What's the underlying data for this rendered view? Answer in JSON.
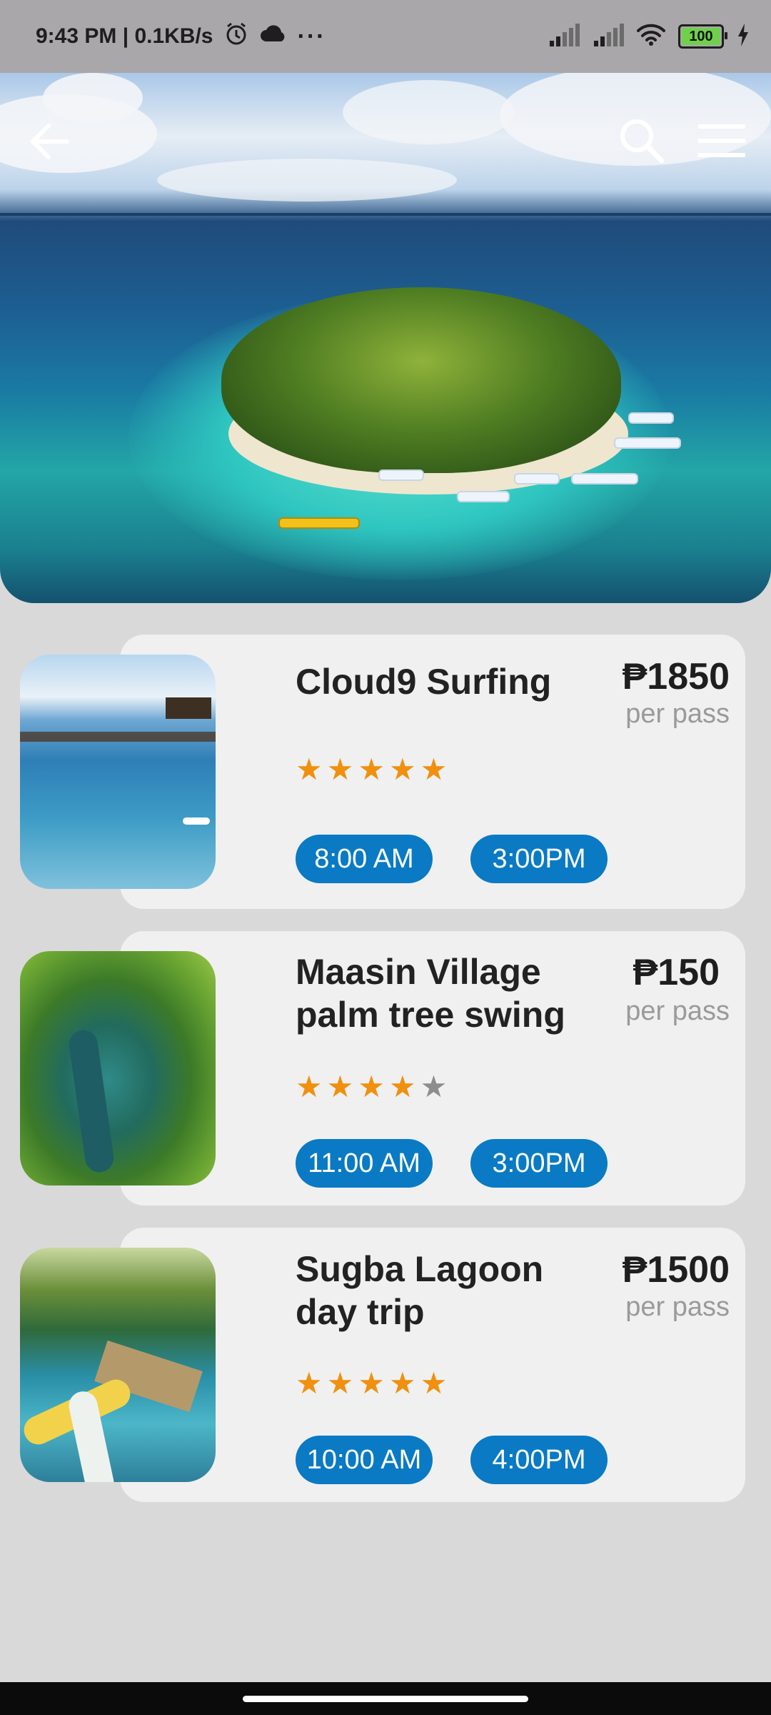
{
  "status_bar": {
    "time_speed": "9:43 PM | 0.1KB/s",
    "more": "···",
    "battery": "100"
  },
  "header": {
    "back_icon": "arrow-left-icon",
    "search_icon": "search-icon",
    "menu_icon": "hamburger-menu-icon"
  },
  "tours": [
    {
      "title": "Cloud9 Surfing",
      "price": "₱1850",
      "price_unit": "per pass",
      "rating": 5,
      "times": [
        "8:00 AM",
        "3:00PM"
      ]
    },
    {
      "title": "Maasin Village palm tree swing",
      "price": "₱150",
      "price_unit": "per pass",
      "rating": 4,
      "times": [
        "11:00 AM",
        "3:00PM"
      ]
    },
    {
      "title": "Sugba Lagoon day trip",
      "price": "₱1500",
      "price_unit": "per pass",
      "rating": 5,
      "times": [
        "10:00 AM",
        "4:00PM"
      ]
    }
  ],
  "colors": {
    "accent": "#0a7ac4",
    "star_on": "#f0900f",
    "star_off": "#8d8d8d"
  }
}
